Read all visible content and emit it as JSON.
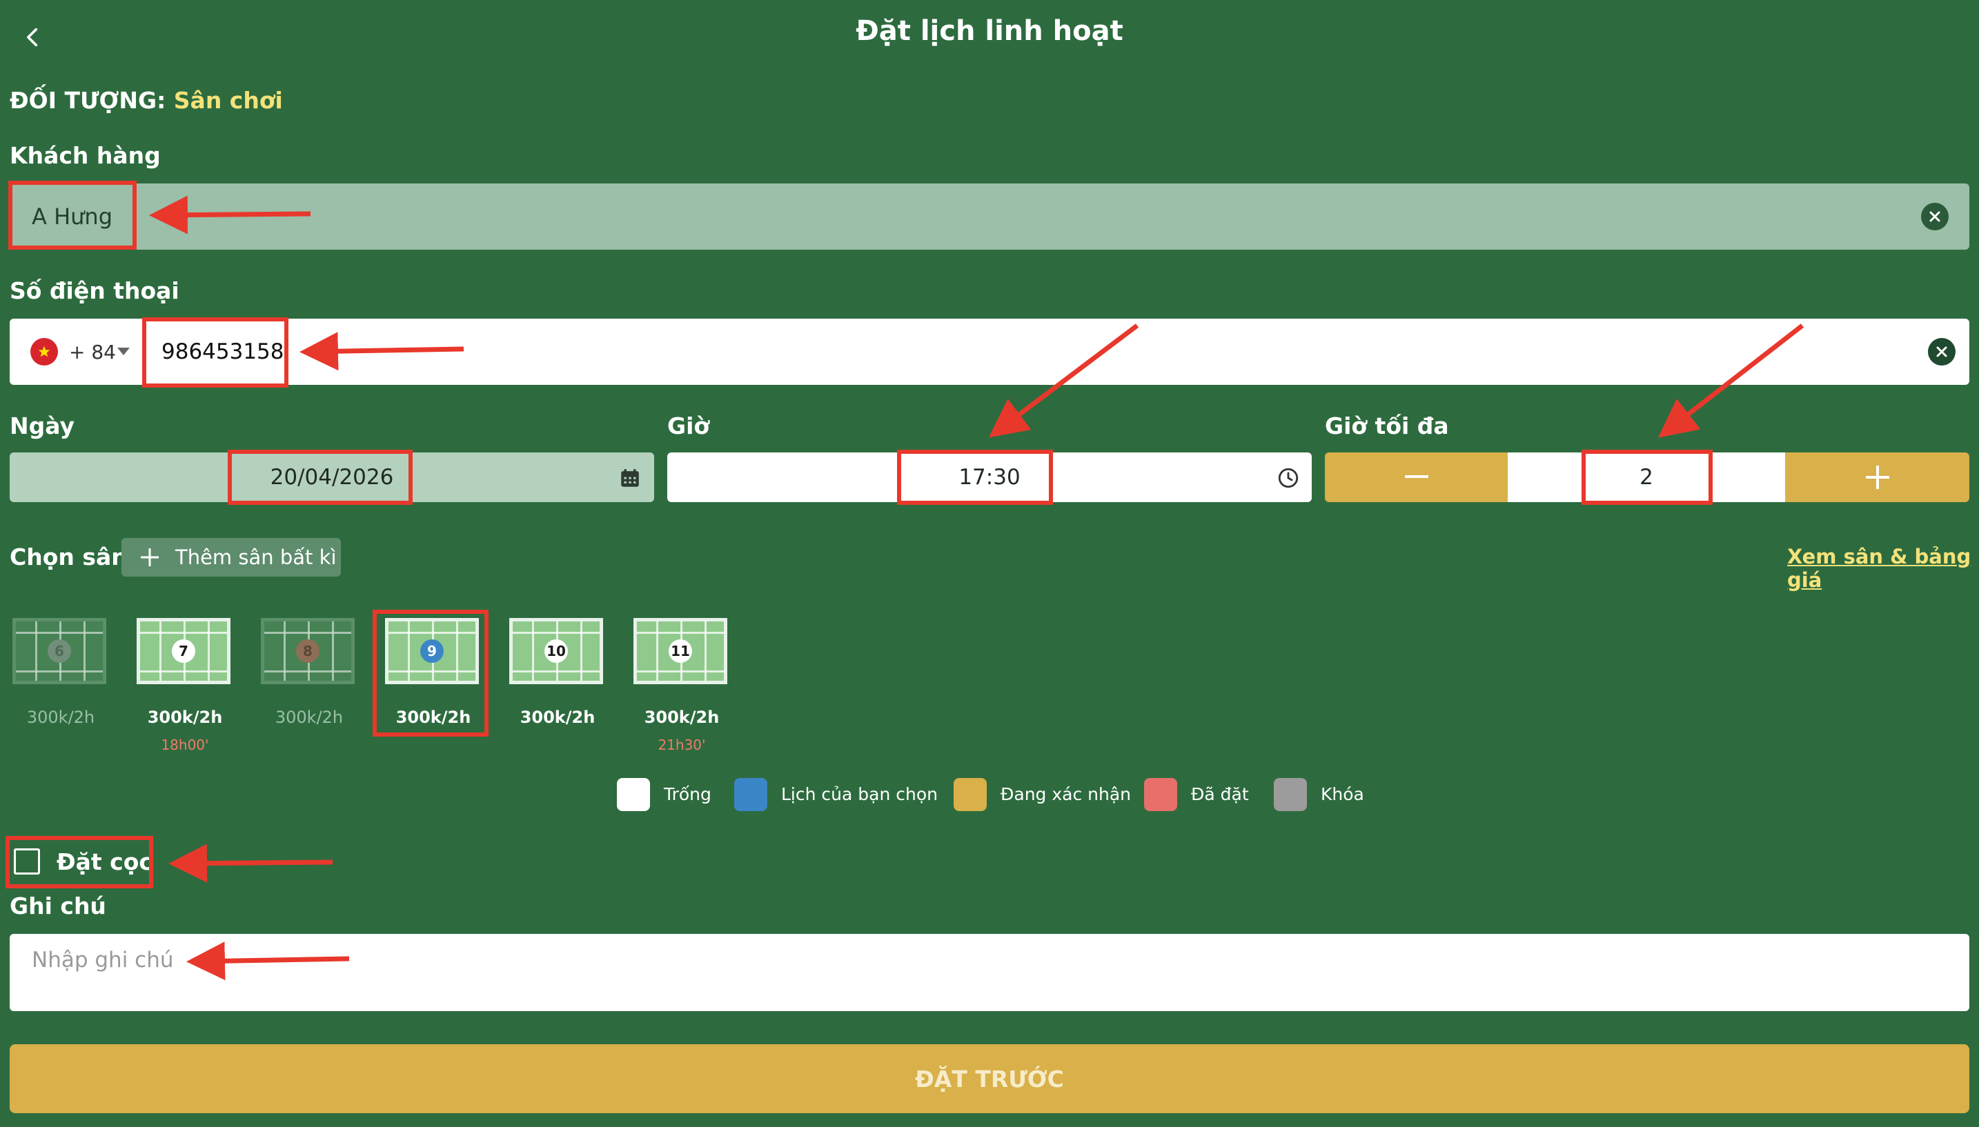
{
  "header": {
    "title": "Đặt lịch linh hoạt"
  },
  "object": {
    "label": "ĐỐI TƯỢNG:",
    "value": "Sân chơi"
  },
  "customer": {
    "label": "Khách hàng",
    "value": "A Hưng"
  },
  "phone": {
    "label": "Số điện thoại",
    "country_code": "+ 84",
    "value": "986453158"
  },
  "date": {
    "label": "Ngày",
    "value": "20/04/2026"
  },
  "time": {
    "label": "Giờ",
    "value": "17:30"
  },
  "max_hours": {
    "label": "Giờ tối đa",
    "value": "2",
    "minus": "–",
    "plus": "+"
  },
  "court_select": {
    "label": "Chọn sân",
    "add_label": "Thêm sân bất kì",
    "view_link": "Xem sân & bảng giá"
  },
  "courts": [
    {
      "number": "6",
      "price": "300k/2h",
      "time": "",
      "state": "locked"
    },
    {
      "number": "7",
      "price": "300k/2h",
      "time": "18h00'",
      "state": "available"
    },
    {
      "number": "8",
      "price": "300k/2h",
      "time": "",
      "state": "booked"
    },
    {
      "number": "9",
      "price": "300k/2h",
      "time": "",
      "state": "selected"
    },
    {
      "number": "10",
      "price": "300k/2h",
      "time": "",
      "state": "available"
    },
    {
      "number": "11",
      "price": "300k/2h",
      "time": "21h30'",
      "state": "available"
    }
  ],
  "legend": [
    {
      "label": "Trống",
      "color": "#ffffff"
    },
    {
      "label": "Lịch của bạn chọn",
      "color": "#3b86c7"
    },
    {
      "label": "Đang xác nhận",
      "color": "#d9b04a"
    },
    {
      "label": "Đã đặt",
      "color": "#e8706b"
    },
    {
      "label": "Khóa",
      "color": "#9c9c9c"
    }
  ],
  "deposit": {
    "label": "Đặt cọc",
    "checked": false
  },
  "note": {
    "label": "Ghi chú",
    "placeholder": "Nhập ghi chú"
  },
  "submit": {
    "label": "ĐẶT TRƯỚC"
  },
  "colors": {
    "background": "#2d6b3e",
    "accent": "#d9b04a",
    "highlight": "#f4e27a",
    "annotation": "#e8382c"
  }
}
